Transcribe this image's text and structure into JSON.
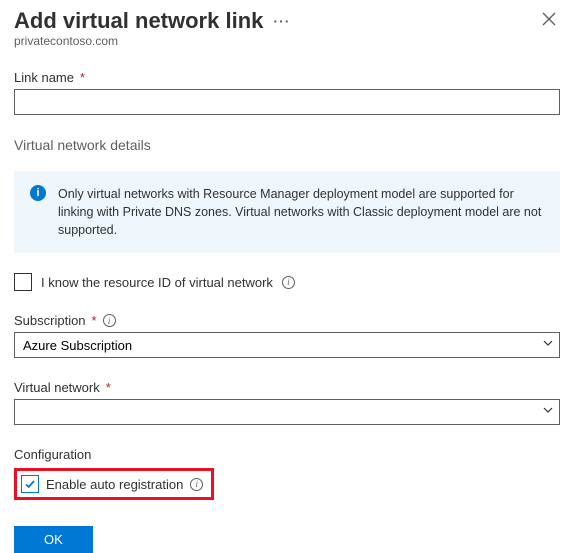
{
  "header": {
    "title": "Add virtual network link",
    "subtitle": "privatecontoso.com"
  },
  "fields": {
    "link_name": {
      "label": "Link name",
      "value": ""
    },
    "vnet_details_heading": "Virtual network details",
    "info_banner": "Only virtual networks with Resource Manager deployment model are supported for linking with Private DNS zones. Virtual networks with Classic deployment model are not supported.",
    "know_resource_id": {
      "label": "I know the resource ID of virtual network"
    },
    "subscription": {
      "label": "Subscription",
      "value": "Azure Subscription"
    },
    "virtual_network": {
      "label": "Virtual network",
      "value": ""
    },
    "configuration_heading": "Configuration",
    "enable_auto_reg": {
      "label": "Enable auto registration"
    }
  },
  "buttons": {
    "ok": "OK"
  }
}
